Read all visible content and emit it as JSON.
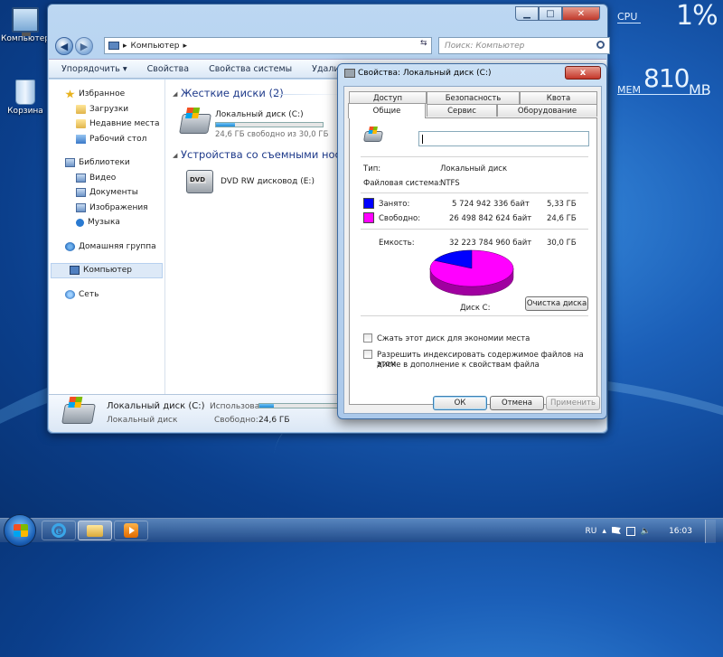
{
  "desktop": {
    "icons": [
      {
        "label": "Компьютер"
      },
      {
        "label": "Корзина"
      }
    ]
  },
  "gadgets": {
    "cpu_label": "CPU",
    "cpu_value": "1%",
    "cpu_usage_fraction": 0.01,
    "mem_label": "MEM",
    "mem_value": "810",
    "mem_unit": "MB"
  },
  "explorer": {
    "breadcrumb": "Компьютер",
    "search_placeholder": "Поиск: Компьютер",
    "toolbar": [
      "Упорядочить ▾",
      "Свойства",
      "Свойства системы",
      "Удалить и"
    ],
    "nav": {
      "favorites": "Избранное",
      "downloads": "Загрузки",
      "recent": "Недавние места",
      "desktop": "Рабочий стол",
      "libraries": "Библиотеки",
      "video": "Видео",
      "documents": "Документы",
      "images": "Изображения",
      "music": "Музыка",
      "homegroup": "Домашняя группа",
      "computer": "Компьютер",
      "network": "Сеть"
    },
    "groups": {
      "hard_disks": "Жесткие диски (2)",
      "removable": "Устройства со съемными носите"
    },
    "drives": {
      "c_name": "Локальный диск (C:)",
      "c_free": "24,6 ГБ свободно из 30,0 ГБ",
      "c_used_fraction": 0.18,
      "dvd_name": "DVD RW дисковод (E:)",
      "dvd_badge": "DVD"
    },
    "details": {
      "name": "Локальный диск (C:)",
      "type": "Локальный диск",
      "used_label": "Использовано:",
      "free_label": "Свободно:",
      "free_value": "24,6 ГБ"
    }
  },
  "dialog": {
    "title": "Свойства: Локальный диск (C:)",
    "close": "x",
    "tabs_row1": [
      "Доступ",
      "Безопасность",
      "Квота"
    ],
    "tabs_row2": [
      "Общие",
      "Сервис",
      "Оборудование"
    ],
    "name_value": "",
    "type_label": "Тип:",
    "type_value": "Локальный диск",
    "fs_label": "Файловая система:",
    "fs_value": "NTFS",
    "used_label": "Занято:",
    "used_bytes": "5 724 942 336 байт",
    "used_gb": "5,33 ГБ",
    "free_label": "Свободно:",
    "free_bytes": "26 498 842 624 байт",
    "free_gb": "24,6 ГБ",
    "capacity_label": "Емкость:",
    "capacity_bytes": "32 223 784 960 байт",
    "capacity_gb": "30,0 ГБ",
    "disk_label": "Диск C:",
    "cleanup_button": "Очистка диска",
    "compress_label": "Сжать этот диск для экономии места",
    "index_label_1": "Разрешить индексировать содержимое файлов на этом",
    "index_label_2": "диске в дополнение к свойствам файла",
    "ok": "ОК",
    "cancel": "Отмена",
    "apply": "Применить",
    "colors": {
      "used": "#0000ff",
      "free": "#ff00ff"
    },
    "pie": {
      "used_fraction": 0.178,
      "free_fraction": 0.822
    }
  },
  "taskbar": {
    "lang": "RU",
    "time": "16:03"
  }
}
